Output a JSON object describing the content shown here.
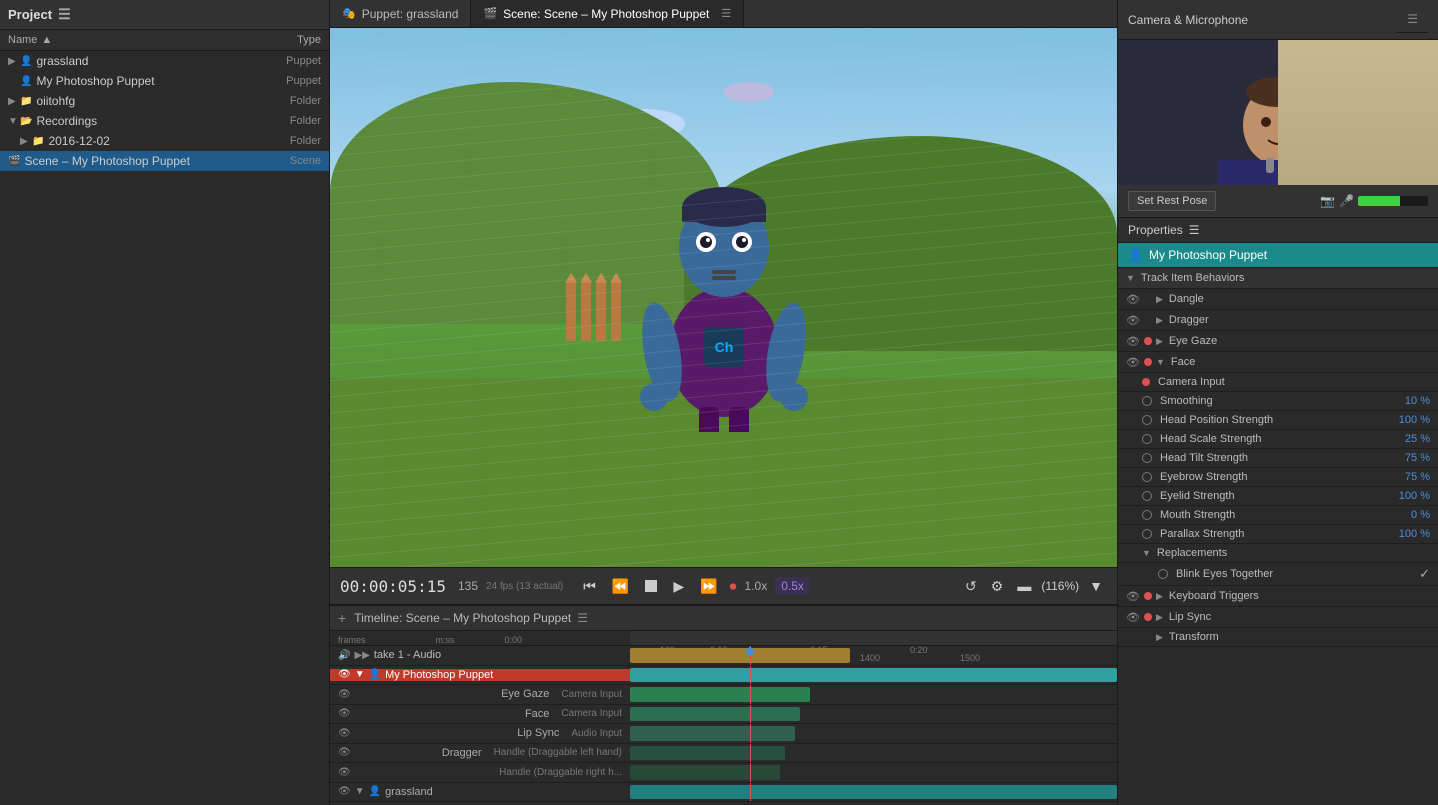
{
  "left_panel": {
    "title": "Project",
    "columns": {
      "name": "Name",
      "type": "Type"
    },
    "items": [
      {
        "name": "grassland",
        "type": "Puppet",
        "indent": 0,
        "icon": "puppet"
      },
      {
        "name": "My Photoshop Puppet",
        "type": "Puppet",
        "indent": 1,
        "icon": "puppet"
      },
      {
        "name": "oiitohfg",
        "type": "Folder",
        "indent": 0,
        "icon": "folder"
      },
      {
        "name": "Recordings",
        "type": "Folder",
        "indent": 0,
        "icon": "folder",
        "expanded": true
      },
      {
        "name": "2016-12-02",
        "type": "Folder",
        "indent": 1,
        "icon": "folder"
      },
      {
        "name": "Scene – My Photoshop Puppet",
        "type": "Scene",
        "indent": 0,
        "icon": "scene"
      }
    ]
  },
  "scene_tabs": {
    "puppet_tab": "Puppet: grassland",
    "scene_tab": "Scene: Scene – My Photoshop Puppet"
  },
  "playback": {
    "timecode": "00:00:05:15",
    "frame": "135",
    "fps_label": "24 fps (13 actual)",
    "speed": "1.0x",
    "zoom": "0.5x",
    "zoom_percent": "(116%)"
  },
  "timeline": {
    "title": "Timeline: Scene – My Photoshop Puppet",
    "ruler_labels": [
      "frames",
      "m:ss",
      "0:00",
      "100",
      "1:00",
      "1200",
      "0:10",
      "1300",
      "0:15",
      "1400",
      "0:20",
      "1500"
    ],
    "tracks": [
      {
        "name": "take 1 - Audio",
        "sub": "",
        "type": "audio"
      },
      {
        "name": "My Photoshop Puppet",
        "sub": "",
        "type": "puppet"
      },
      {
        "name": "Eye Gaze",
        "sub": "Camera Input",
        "type": "behavior"
      },
      {
        "name": "Face",
        "sub": "Camera Input",
        "type": "behavior"
      },
      {
        "name": "Lip Sync",
        "sub": "Audio Input",
        "type": "behavior"
      },
      {
        "name": "Dragger",
        "sub": "Handle (Draggable left hand)",
        "type": "behavior"
      },
      {
        "name": "",
        "sub": "Handle (Draggable right h...",
        "type": "behavior"
      },
      {
        "name": "grassland",
        "sub": "",
        "type": "puppet"
      }
    ]
  },
  "right_panel": {
    "camera_title": "Camera & Microphone",
    "rest_pose_btn": "Set Rest Pose",
    "properties_title": "Properties",
    "puppet_name": "My Photoshop Puppet",
    "section_title": "Track Item Behaviors",
    "behaviors": [
      {
        "name": "Dangle",
        "value": "",
        "level": 1
      },
      {
        "name": "Dragger",
        "value": "",
        "level": 1
      },
      {
        "name": "Eye Gaze",
        "value": "",
        "level": 1,
        "active": true
      },
      {
        "name": "Face",
        "value": "",
        "level": 1,
        "active": true,
        "expanded": true
      },
      {
        "name": "Camera Input",
        "value": "",
        "level": 2,
        "active": true
      },
      {
        "name": "Smoothing",
        "value": "10 %",
        "level": 2
      },
      {
        "name": "Head Position Strength",
        "value": "100 %",
        "level": 2
      },
      {
        "name": "Head Scale Strength",
        "value": "25 %",
        "level": 2
      },
      {
        "name": "Head Tilt Strength",
        "value": "75 %",
        "level": 2
      },
      {
        "name": "Eyebrow Strength",
        "value": "75 %",
        "level": 2
      },
      {
        "name": "Eyelid Strength",
        "value": "100 %",
        "level": 2
      },
      {
        "name": "Mouth Strength",
        "value": "0 %",
        "level": 2
      },
      {
        "name": "Parallax Strength",
        "value": "100 %",
        "level": 2
      },
      {
        "name": "Replacements",
        "value": "",
        "level": 2,
        "expanded": true
      },
      {
        "name": "Blink Eyes Together",
        "value": "✓",
        "level": 3
      },
      {
        "name": "Keyboard Triggers",
        "value": "",
        "level": 1,
        "active": true
      },
      {
        "name": "Lip Sync",
        "value": "",
        "level": 1,
        "active": true
      },
      {
        "name": "Transform",
        "value": "",
        "level": 1
      }
    ]
  }
}
